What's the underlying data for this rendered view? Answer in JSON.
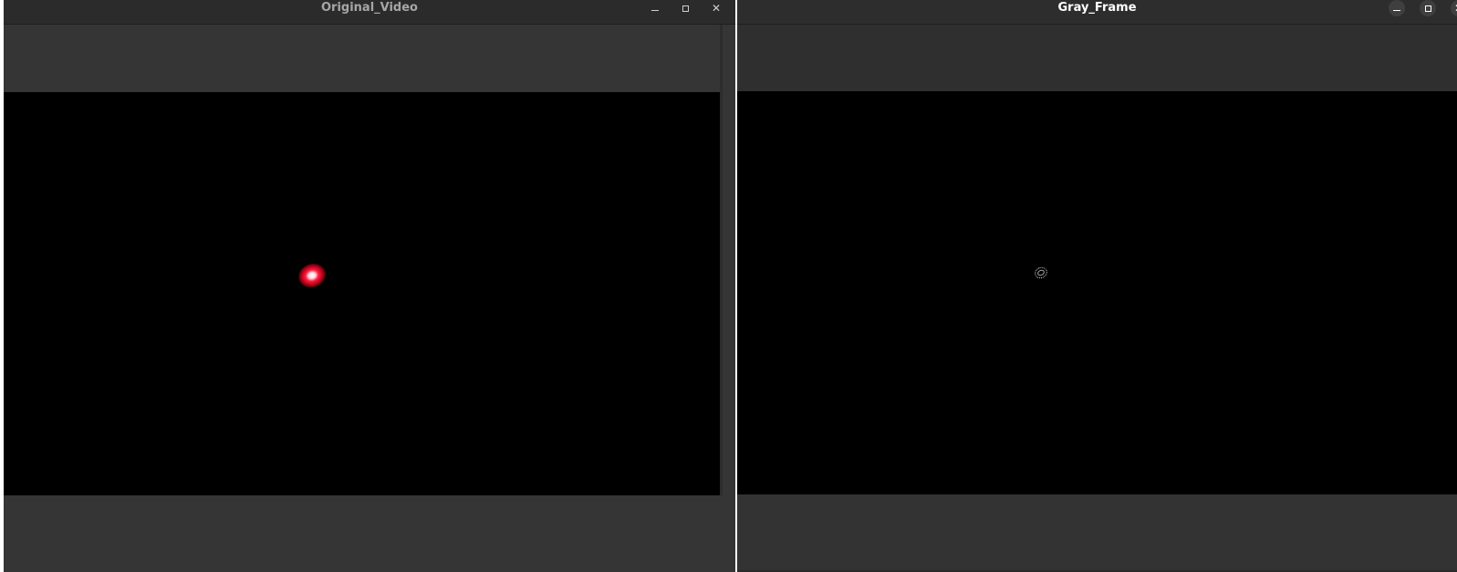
{
  "windows": [
    {
      "title": "Original_Video",
      "controls": {
        "minimize": "–",
        "maximize": "",
        "close": "✕"
      },
      "frame_content": "red-laser-spot"
    },
    {
      "title": "Gray_Frame",
      "controls": {
        "minimize": "–",
        "maximize": "",
        "close": "✕"
      },
      "frame_content": "edge-outline"
    }
  ],
  "colors": {
    "window_chrome": "#353535",
    "titlebar": "#2b2b2b",
    "video_background": "#000000",
    "spot_color": "#ff1a3d"
  },
  "icons": {
    "minimize": "minimize-icon",
    "maximize": "maximize-icon",
    "close": "close-icon"
  }
}
